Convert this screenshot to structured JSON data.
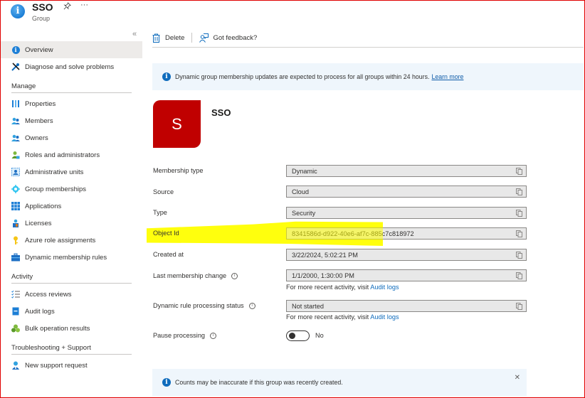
{
  "header": {
    "title": "SSO",
    "subtitle": "Group",
    "icon": "info-icon",
    "pin_icon": "📌",
    "more_label": "···"
  },
  "sidebar": {
    "collapse_label": "«",
    "top_items": [
      {
        "label": "Overview",
        "icon": "info-icon",
        "active": true
      },
      {
        "label": "Diagnose and solve problems",
        "icon": "wrench-icon",
        "active": false
      }
    ],
    "sections": [
      {
        "title": "Manage",
        "items": [
          {
            "label": "Properties",
            "icon": "properties-icon"
          },
          {
            "label": "Members",
            "icon": "members-icon"
          },
          {
            "label": "Owners",
            "icon": "owners-icon"
          },
          {
            "label": "Roles and administrators",
            "icon": "roles-icon"
          },
          {
            "label": "Administrative units",
            "icon": "admin-units-icon"
          },
          {
            "label": "Group memberships",
            "icon": "group-memberships-icon"
          },
          {
            "label": "Applications",
            "icon": "applications-icon"
          },
          {
            "label": "Licenses",
            "icon": "licenses-icon"
          },
          {
            "label": "Azure role assignments",
            "icon": "key-icon"
          },
          {
            "label": "Dynamic membership rules",
            "icon": "briefcase-icon"
          }
        ]
      },
      {
        "title": "Activity",
        "items": [
          {
            "label": "Access reviews",
            "icon": "checklist-icon"
          },
          {
            "label": "Audit logs",
            "icon": "book-icon"
          },
          {
            "label": "Bulk operation results",
            "icon": "bulk-icon"
          }
        ]
      },
      {
        "title": "Troubleshooting + Support",
        "items": [
          {
            "label": "New support request",
            "icon": "support-icon"
          }
        ]
      }
    ]
  },
  "toolbar": {
    "delete_label": "Delete",
    "feedback_label": "Got feedback?"
  },
  "banner": {
    "text": "Dynamic group membership updates are expected to process for all groups within 24 hours.",
    "link": "Learn more"
  },
  "group": {
    "avatar_letter": "S",
    "avatar_color": "#c00000",
    "name": "SSO"
  },
  "properties": [
    {
      "label": "Membership type",
      "value": "Dynamic"
    },
    {
      "label": "Source",
      "value": "Cloud"
    },
    {
      "label": "Type",
      "value": "Security"
    },
    {
      "label": "Object Id",
      "value": "8341586d-d922-40e6-af7c-885c7c818972",
      "highlighted": true
    },
    {
      "label": "Created at",
      "value": "3/22/2024, 5:02:21 PM"
    },
    {
      "label": "Last membership change",
      "value": "1/1/2000, 1:30:00 PM",
      "info": true,
      "note": "For more recent activity, visit",
      "note_link": "Audit logs"
    },
    {
      "label": "Dynamic rule processing status",
      "value": "Not started",
      "info": true,
      "note": "For more recent activity, visit",
      "note_link": "Audit logs"
    }
  ],
  "pause": {
    "label": "Pause processing",
    "state_label": "No",
    "on": false
  },
  "bottom_banner": {
    "text": "Counts may be inaccurate if this group was recently created.",
    "close": "✕"
  },
  "colors": {
    "accent": "#0f6cbd",
    "highlight": "#ffff00",
    "frame": "#e00000"
  }
}
